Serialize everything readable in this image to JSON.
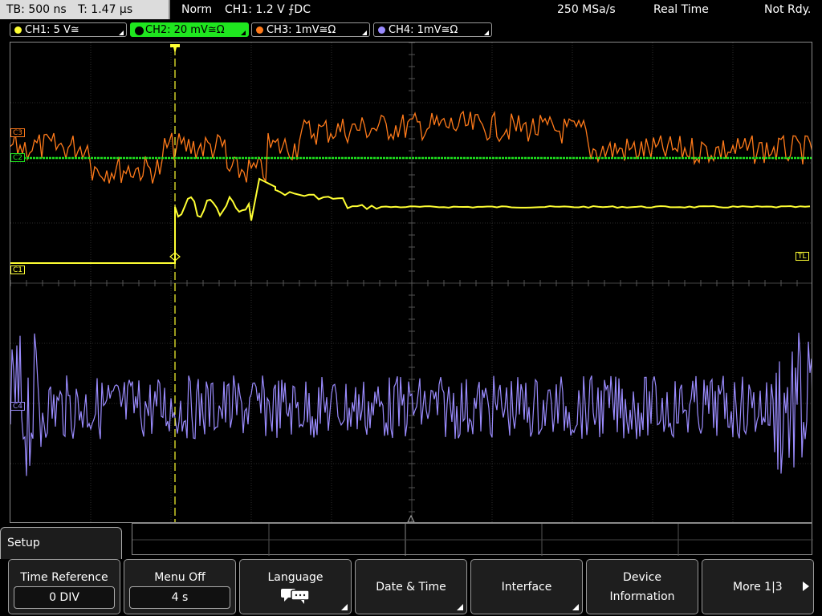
{
  "header": {
    "timebase": "TB: 500 ns",
    "trigger_time": "T: 1.47 µs",
    "mode": "Norm",
    "trigger_info": "CH1: 1.2 V ⨍DC",
    "sample_rate": "250 MSa/s",
    "acq_mode": "Real Time",
    "state": "Not Rdy."
  },
  "channels": [
    {
      "label": "CH1: 5 V≅",
      "color": "#ffff33"
    },
    {
      "label": "CH2: 20 mV≅Ω",
      "color": "#1fe61f"
    },
    {
      "label": "CH3: 1mV≅Ω",
      "color": "#ff7a1a"
    },
    {
      "label": "CH4: 1mV≅Ω",
      "color": "#9b8cff"
    }
  ],
  "markers": {
    "c1": "C1",
    "c2": "C2",
    "c3": "C3",
    "c4": "C4",
    "trigger_level": "TL"
  },
  "menu": {
    "title": "Setup",
    "softkeys": [
      {
        "label": "Time Reference",
        "value": "0 DIV"
      },
      {
        "label": "Menu Off",
        "value": "4 s"
      },
      {
        "label": "Language",
        "icon": "speech-bubbles-icon"
      },
      {
        "label": "Date & Time"
      },
      {
        "label": "Interface"
      },
      {
        "label_line1": "Device",
        "label_line2": "Information"
      },
      {
        "label": "More 1|3",
        "icon": "right-arrow-icon"
      }
    ]
  }
}
